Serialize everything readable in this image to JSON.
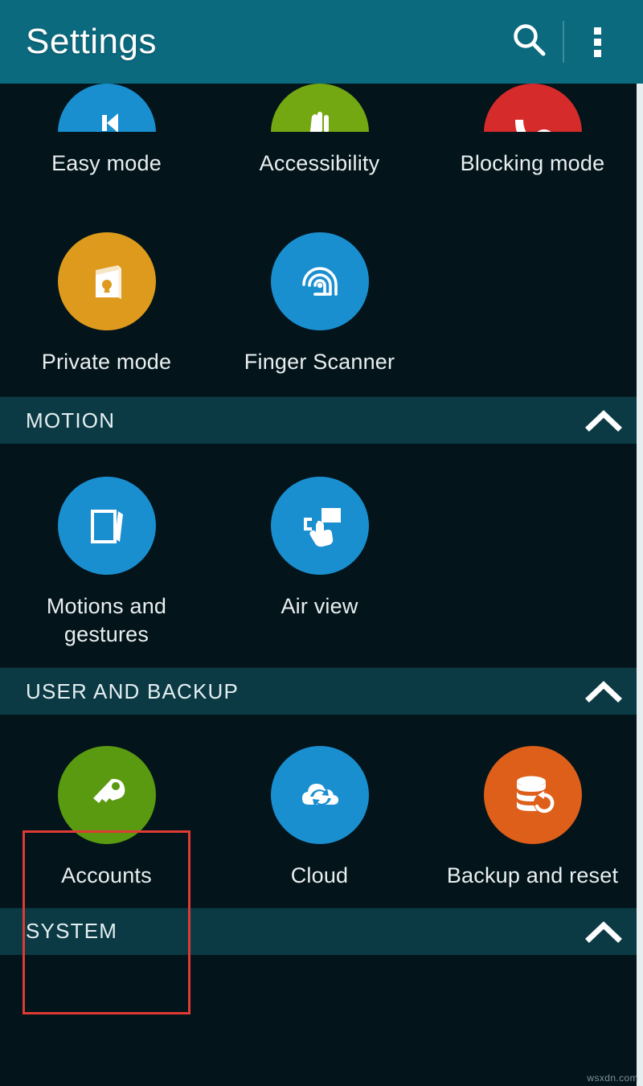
{
  "app": {
    "title": "Settings",
    "header_color": "#0b6a7e",
    "background_color": "#03141a",
    "section_band_color": "#0b3a44",
    "highlight_color": "#e03a34",
    "watermark": "wsxdn.com"
  },
  "header": {
    "title": "Settings",
    "search_icon": "search-icon",
    "overflow_icon": "more-options-icon"
  },
  "rows": [
    {
      "id": "row-personalization-partial",
      "clipped": true,
      "items": [
        {
          "label": "Easy mode",
          "icon": "easy-mode-icon",
          "color": "#1a8fd0"
        },
        {
          "label": "Accessibility",
          "icon": "accessibility-icon",
          "color": "#73a812"
        },
        {
          "label": "Blocking mode",
          "icon": "blocking-mode-icon",
          "color": "#d62b2b"
        }
      ]
    },
    {
      "id": "row-privacy",
      "clipped": false,
      "items": [
        {
          "label": "Private mode",
          "icon": "private-mode-icon",
          "color": "#dd9a1d"
        },
        {
          "label": "Finger Scanner",
          "icon": "fingerprint-icon",
          "color": "#1a8fd0"
        }
      ]
    }
  ],
  "sections": [
    {
      "id": "motion",
      "title": "MOTION",
      "collapse_icon": "chevron-up-icon",
      "items": [
        {
          "label": "Motions and gestures",
          "icon": "motions-gestures-icon",
          "color": "#1a8fd0"
        },
        {
          "label": "Air view",
          "icon": "air-view-icon",
          "color": "#1a8fd0"
        }
      ]
    },
    {
      "id": "user-and-backup",
      "title": "USER AND BACKUP",
      "collapse_icon": "chevron-up-icon",
      "items": [
        {
          "label": "Accounts",
          "icon": "key-icon",
          "color": "#599a10",
          "highlighted": true
        },
        {
          "label": "Cloud",
          "icon": "cloud-sync-icon",
          "color": "#1a8fd0"
        },
        {
          "label": "Backup and reset",
          "icon": "backup-reset-icon",
          "color": "#dd5f1a"
        }
      ]
    },
    {
      "id": "system",
      "title": "SYSTEM",
      "collapse_icon": "chevron-up-icon",
      "items": []
    }
  ]
}
